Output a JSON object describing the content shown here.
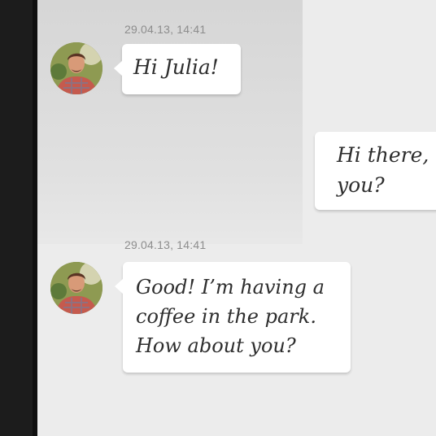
{
  "conversation": {
    "messages": [
      {
        "timestamp": "29.04.13, 14:41",
        "text": "Hi Julia!",
        "sender": "incoming"
      },
      {
        "text": "Hi there, \nyou?",
        "sender": "outgoing"
      },
      {
        "timestamp": "29.04.13, 14:41",
        "text": "Good! I’m having a\ncoffee in the park.\nHow about you?",
        "sender": "incoming"
      }
    ]
  },
  "colors": {
    "background": "#ececec",
    "bubble": "#ffffff",
    "timestamp": "#8d8d8d",
    "text": "#2e2e2e",
    "rail": "#1c1c1c"
  },
  "icons": {
    "avatar": "user-photo-avatar"
  }
}
